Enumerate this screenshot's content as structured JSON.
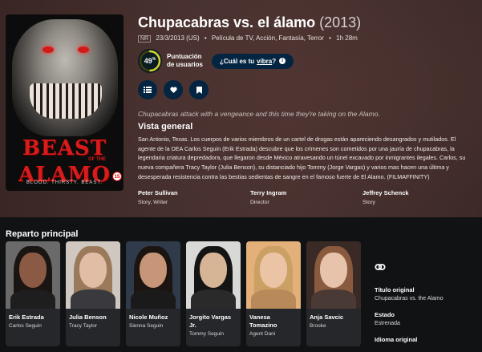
{
  "poster": {
    "title_line1": "BEAST",
    "title_line2": "ALAMO",
    "of_the": "OF THE",
    "tagline": "BLOOD. THIRSTY. BEAST.",
    "age_badge": "15"
  },
  "movie": {
    "title": "Chupacabras vs. el álamo",
    "year": "(2013)",
    "certification": "NR",
    "release": "23/3/2013 (US)",
    "genres": "Película de TV, Acción, Fantasía, Terror",
    "runtime": "1h 28m",
    "score": 49,
    "score_label": "Puntuación de usuarios",
    "vibe_prefix": "¿Cuál es tu",
    "vibe_link": "vibra",
    "vibe_suffix": "?",
    "tagline": "Chupacabras attack with a vengeance and this time they're taking on the Alamo.",
    "overview_heading": "Vista general",
    "overview": "San Antonio, Texas. Los cuerpos de varios miembros de un cartel de drogas están apareciendo desangrados y mutilados. El agente de la DEA Carlos Seguin (Erik Estrada) descubre que los crímenes son cometidos por una jauría de chupacabras, la legendaria criatura depredadora, que llegaron desde México atravesando un túnel excavado por inmigrantes ilegales. Carlos, su nueva compañera Tracy Taylor (Julia Benson), su distanciado hijo Tommy (Jorge Vargas) y varios mas hacen una última y desesperada resistencia contra las bestias sedientas de sangre en el famoso fuerte de El Alamo. (FILMAFFINITY)",
    "crew": [
      {
        "name": "Peter Sullivan",
        "job": "Story, Writer"
      },
      {
        "name": "Terry Ingram",
        "job": "Director"
      },
      {
        "name": "Jeffrey Schenck",
        "job": "Story"
      }
    ]
  },
  "colors": {
    "score_ring": "#d2d531",
    "score_track": "#423d0f",
    "button_bg": "#032541"
  },
  "cast_heading": "Reparto principal",
  "cast": [
    {
      "name": "Erik Estrada",
      "role": "Carlos Seguin",
      "skin": "#8a5a44",
      "hair": "#1a1412",
      "bg": "#6b6a6a",
      "shirt": "#1e1e1e"
    },
    {
      "name": "Julia Benson",
      "role": "Tracy Taylor",
      "skin": "#e2bda6",
      "hair": "#9a7a5a",
      "bg": "#cfc7c0",
      "shirt": "#3a3a3e"
    },
    {
      "name": "Nicole Muñoz",
      "role": "Sienna Seguin",
      "skin": "#c79679",
      "hair": "#1c1411",
      "bg": "#2f3a4a",
      "shirt": "#1a1a1a"
    },
    {
      "name": "Jorgito Vargas Jr.",
      "role": "Tommy Seguin",
      "skin": "#d6b496",
      "hair": "#141414",
      "bg": "#d8d8d6",
      "shirt": "#2a2a2a"
    },
    {
      "name": "Vanesa Tomazino",
      "role": "Agent Dani",
      "skin": "#eac4a4",
      "hair": "#caa064",
      "bg": "#e3b07a",
      "shirt": "#b88a5a"
    },
    {
      "name": "Anja Savcic",
      "role": "Brooke",
      "skin": "#e7c3ac",
      "hair": "#8a5a3e",
      "bg": "#3a2a26",
      "shirt": "#4a3a36"
    }
  ],
  "sidebar": {
    "link_icon": "link-icon",
    "original_title_label": "Título original",
    "original_title": "Chupacabras vs. the Alamo",
    "status_label": "Estado",
    "status": "Estrenada",
    "language_label": "Idioma original"
  }
}
